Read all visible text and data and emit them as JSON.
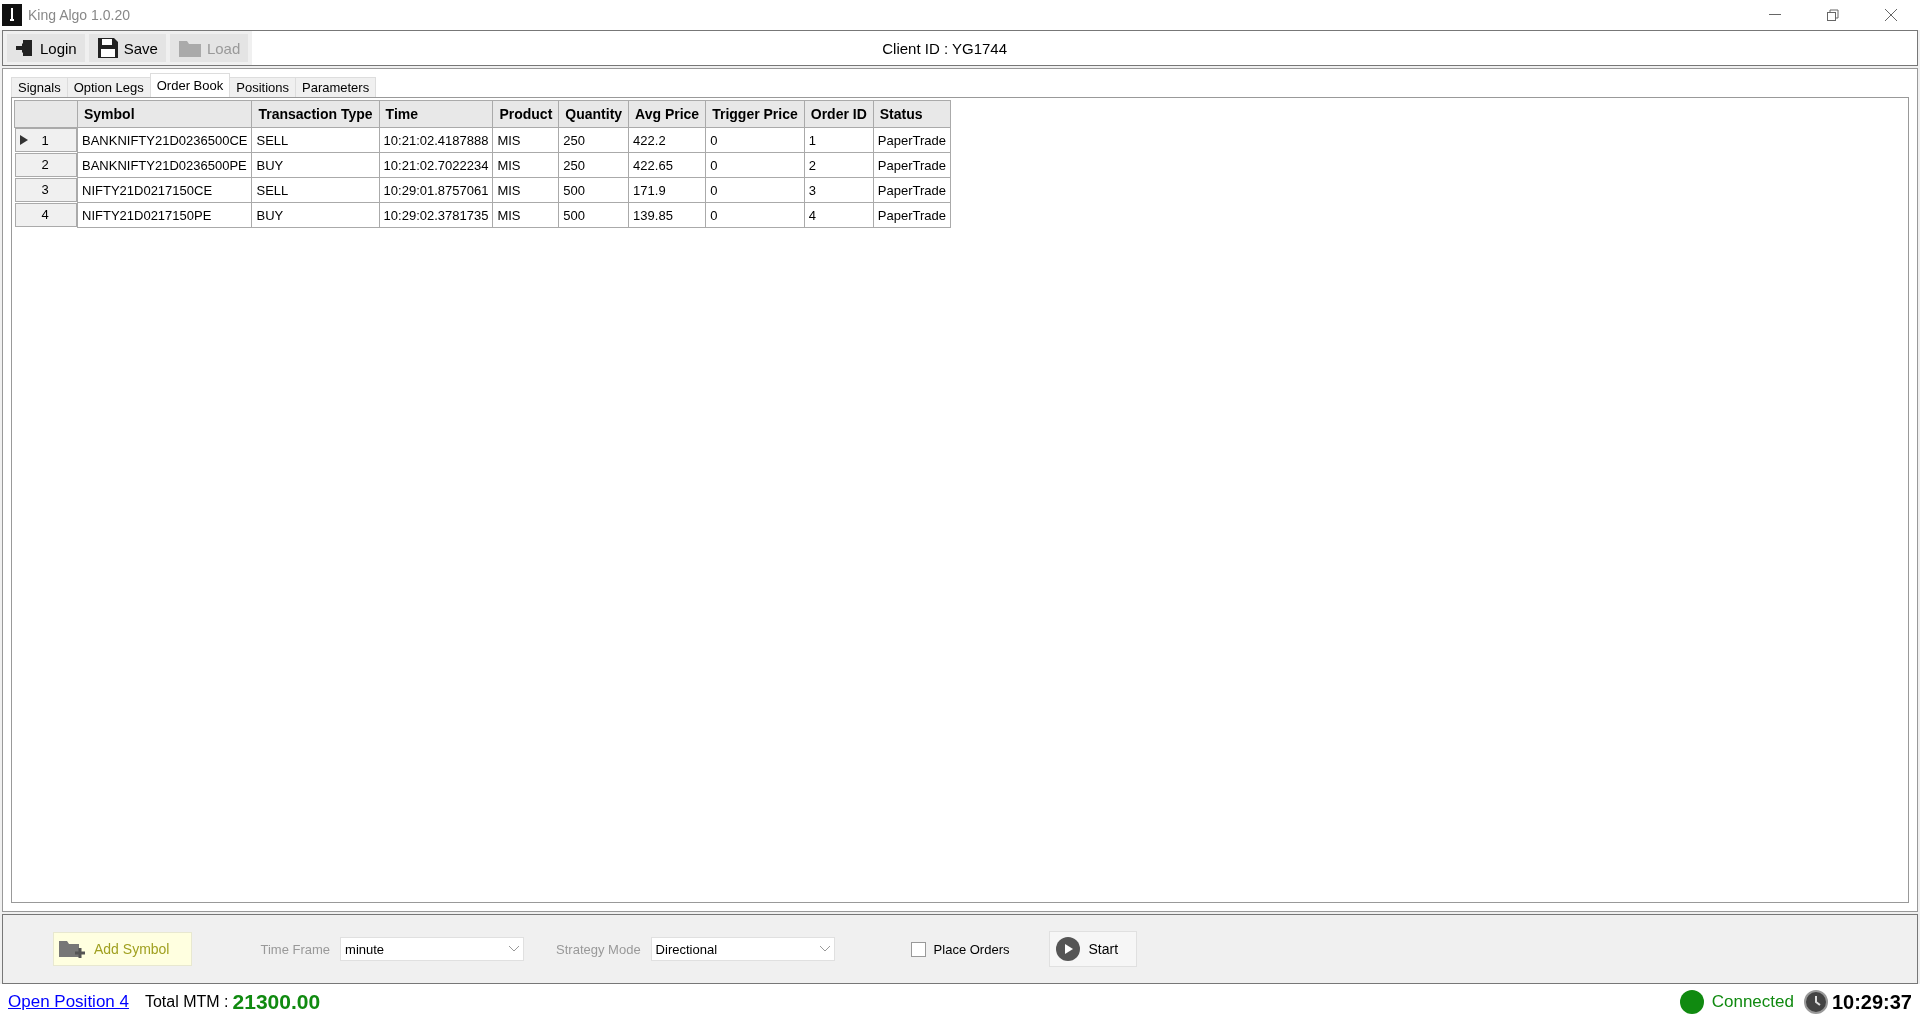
{
  "window": {
    "title": "King Algo 1.0.20"
  },
  "toolbar": {
    "buttons": [
      {
        "label": "Login",
        "kind": "login",
        "disabled": false
      },
      {
        "label": "Save",
        "kind": "save",
        "disabled": false
      },
      {
        "label": "Load",
        "kind": "load",
        "disabled": true
      }
    ],
    "client_id": "Client ID : YG1744"
  },
  "tabs": [
    {
      "label": "Signals",
      "selected": false
    },
    {
      "label": "Option Legs",
      "selected": false
    },
    {
      "label": "Order Book",
      "selected": true
    },
    {
      "label": "Positions",
      "selected": false
    },
    {
      "label": "Parameters",
      "selected": false
    }
  ],
  "table": {
    "columns": [
      "Symbol",
      "Transaction Type",
      "Time",
      "Product",
      "Quantity",
      "Avg Price",
      "Trigger Price",
      "Order ID",
      "Status"
    ],
    "rows": [
      {
        "number": "1",
        "selected": true,
        "cells": [
          "BANKNIFTY21D0236500CE",
          "SELL",
          "10:21:02.4187888",
          "MIS",
          "250",
          "422.2",
          "0",
          "1",
          "PaperTrade"
        ]
      },
      {
        "number": "2",
        "selected": false,
        "cells": [
          "BANKNIFTY21D0236500PE",
          "BUY",
          "10:21:02.7022234",
          "MIS",
          "250",
          "422.65",
          "0",
          "2",
          "PaperTrade"
        ]
      },
      {
        "number": "3",
        "selected": false,
        "cells": [
          "NIFTY21D0217150CE",
          "SELL",
          "10:29:01.8757061",
          "MIS",
          "500",
          "171.9",
          "0",
          "3",
          "PaperTrade"
        ]
      },
      {
        "number": "4",
        "selected": false,
        "cells": [
          "NIFTY21D0217150PE",
          "BUY",
          "10:29:02.3781735",
          "MIS",
          "500",
          "139.85",
          "0",
          "4",
          "PaperTrade"
        ]
      }
    ]
  },
  "controls": {
    "add_symbol": "Add Symbol",
    "time_frame": {
      "label": "Time Frame",
      "value": "minute"
    },
    "strategy_mode": {
      "label": "Strategy Mode",
      "value": "Directional"
    },
    "place_orders": {
      "label": "Place Orders",
      "checked": false
    },
    "start": "Start"
  },
  "status_bar": {
    "open_positions": "Open Position 4",
    "mtm_label": "Total MTM :",
    "mtm_value": "21300.00",
    "connection": {
      "label": "Connected",
      "color": "#108a10"
    },
    "time": "10:29:37"
  }
}
